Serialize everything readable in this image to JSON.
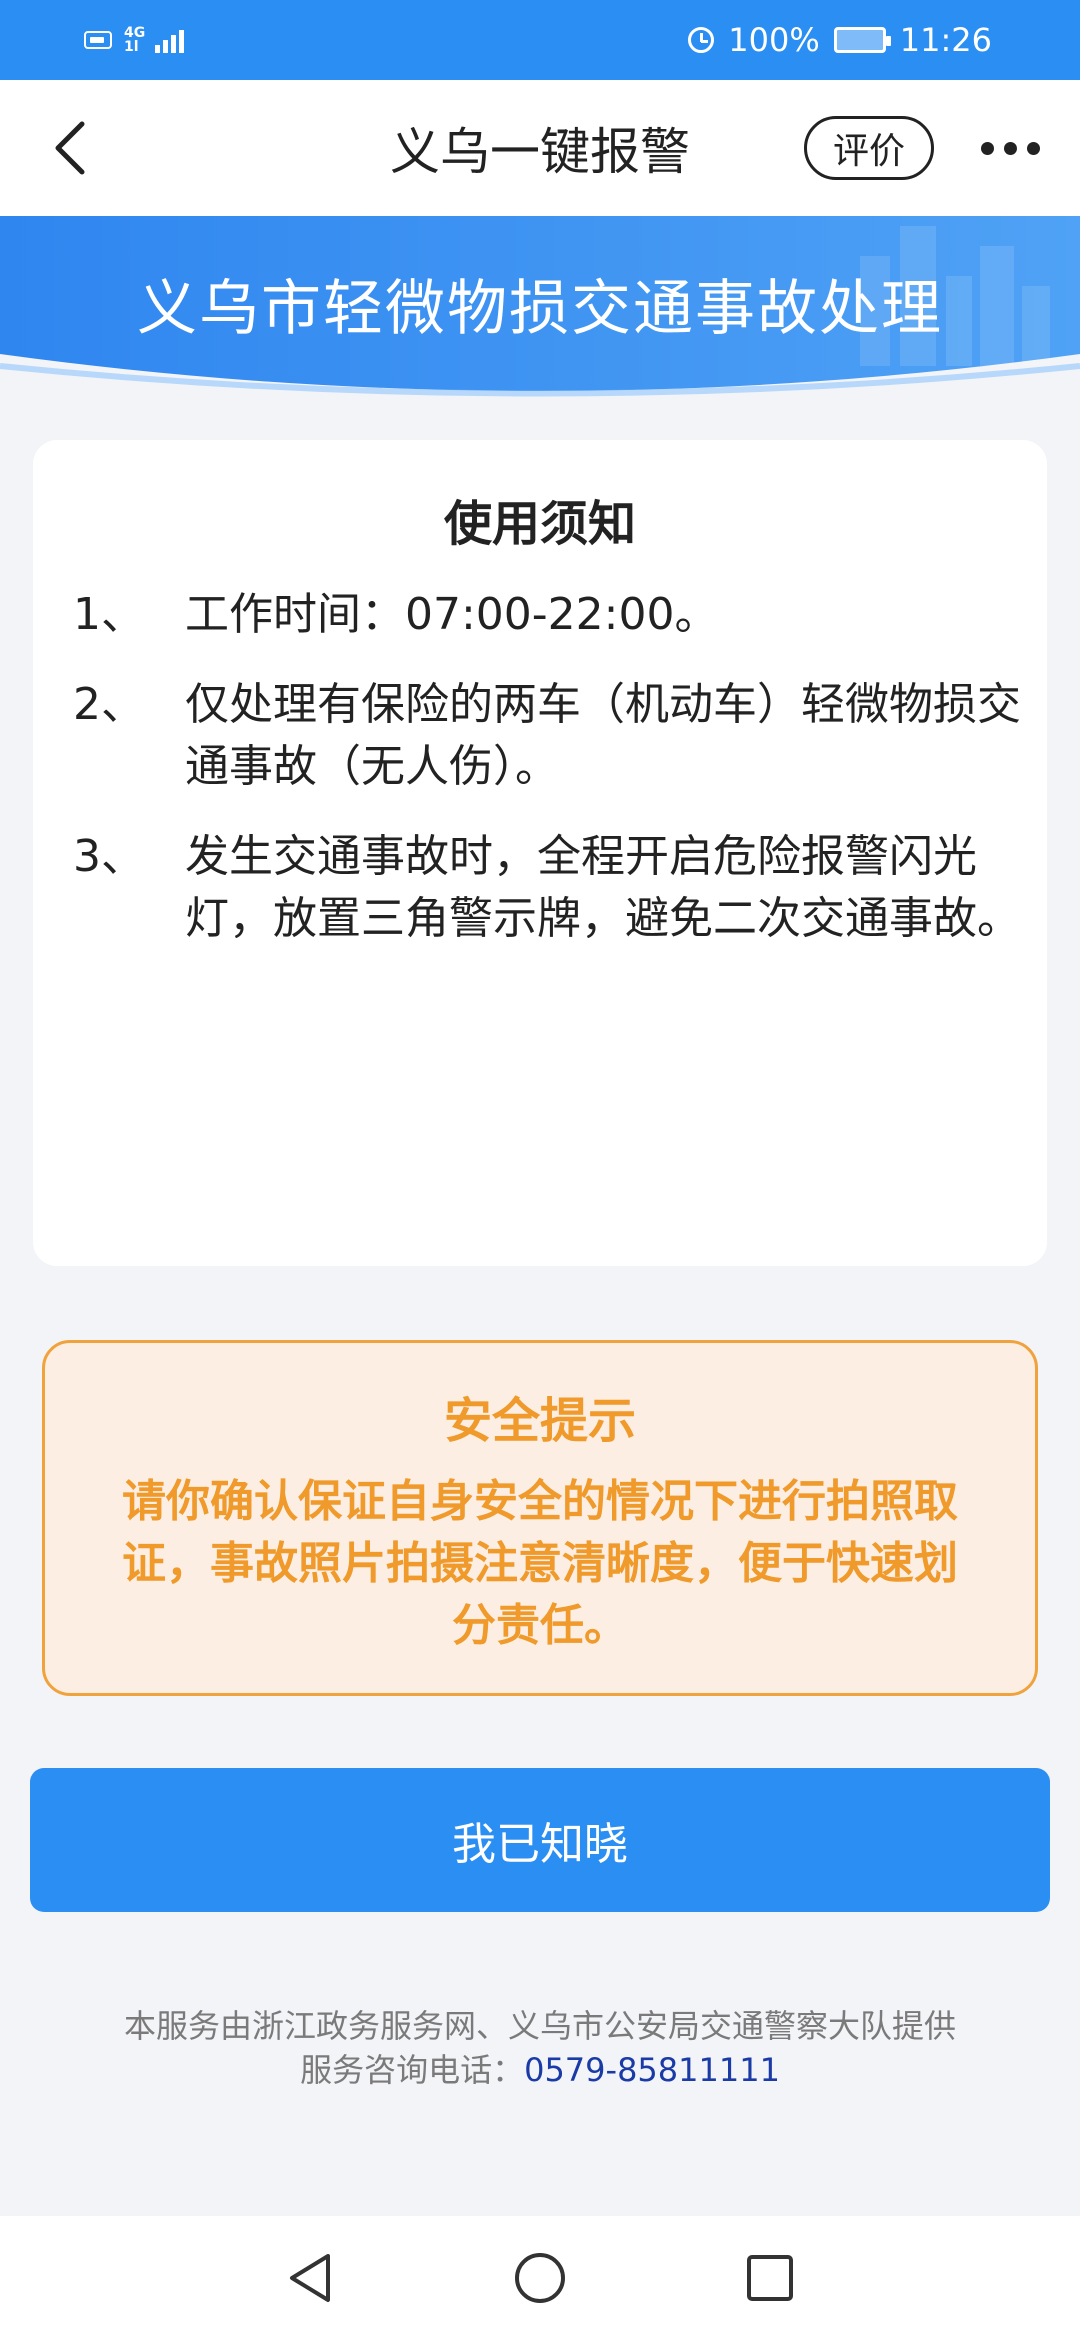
{
  "status_bar": {
    "network_top": "4G",
    "network_bottom": "1l",
    "battery_percent": "100%",
    "time": "11:26"
  },
  "nav": {
    "title": "义乌一键报警",
    "rate_label": "评价"
  },
  "banner": {
    "title": "义乌市轻微物损交通事故处理"
  },
  "notice": {
    "title": "使用须知",
    "items": [
      {
        "num": "1、",
        "text": "工作时间：07:00-22:00。"
      },
      {
        "num": "2、",
        "text": "仅处理有保险的两车（机动车）轻微物损交通事故（无人伤）。"
      },
      {
        "num": "3、",
        "text": "发生交通事故时，全程开启危险报警闪光灯，放置三角警示牌，避免二次交通事故。"
      }
    ]
  },
  "safety": {
    "title": "安全提示",
    "text": "请你确认保证自身安全的情况下进行拍照取证，事故照片拍摄注意清晰度，便于快速划分责任。"
  },
  "confirm_button": {
    "label": "我已知晓"
  },
  "footer": {
    "provider": "本服务由浙江政务服务网、义乌市公安局交通警察大队提供",
    "phone_prefix": "服务咨询电话：",
    "phone": "0579-85811111"
  },
  "colors": {
    "primary_blue": "#2b8ef3",
    "safety_orange": "#ef9a2a",
    "safety_bg": "#fdeee3",
    "page_bg": "#f2f4f8",
    "phone_link": "#1a3aa6"
  },
  "icons": {
    "back": "chevron-left-icon",
    "more": "more-dots-icon",
    "alarm": "alarm-clock-icon",
    "battery": "battery-icon",
    "sys_back": "triangle-back-icon",
    "sys_home": "circle-home-icon",
    "sys_recent": "square-recent-icon"
  }
}
